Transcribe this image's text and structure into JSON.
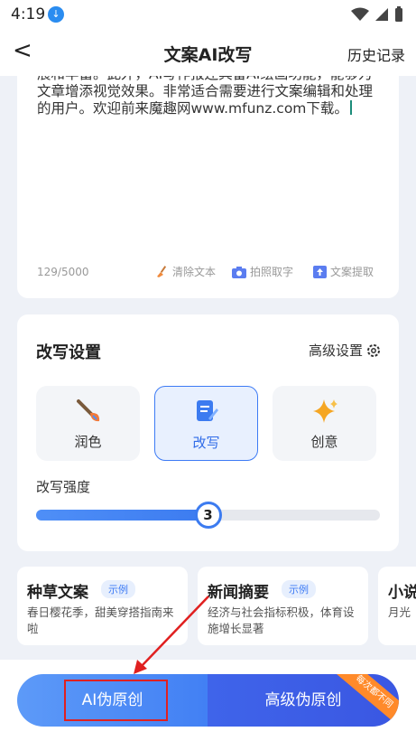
{
  "status_bar": {
    "time": "4:19"
  },
  "header": {
    "back": "<",
    "title": "文案AI改写",
    "history": "历史记录"
  },
  "editor": {
    "line1": "展和丰富。此外，AI写作报还具备AI绘画功能，能够为",
    "line2": "文章增添视觉效果。非常适合需要进行文案编辑和处理",
    "line3": "的用户。欢迎前来魔趣网www.mfunz.com下载。",
    "counter": "129/5000",
    "tools": [
      "清除文本",
      "拍照取字",
      "文案提取"
    ]
  },
  "settings": {
    "title": "改写设置",
    "advanced": "高级设置",
    "modes": [
      {
        "label": "润色",
        "selected": false
      },
      {
        "label": "改写",
        "selected": true
      },
      {
        "label": "创意",
        "selected": false
      }
    ],
    "strength_label": "改写强度",
    "strength_value": "3",
    "strength_fraction": 0.5
  },
  "templates": [
    {
      "name": "种草文案",
      "badge": "示例",
      "desc": "春日樱花季，甜美穿搭指南来啦"
    },
    {
      "name": "新闻摘要",
      "badge": "示例",
      "desc": "经济与社会指标积极，体育设施增长显著"
    },
    {
      "name": "小说",
      "badge": "",
      "desc": "月光"
    }
  ],
  "bottom": {
    "ai_button": "AI伪原创",
    "adv_button": "高级伪原创",
    "ribbon": "每次都不同"
  },
  "colors": {
    "accent": "#3c7bf0",
    "highlight": "#e02020",
    "ribbon": "#ff8a2a"
  }
}
